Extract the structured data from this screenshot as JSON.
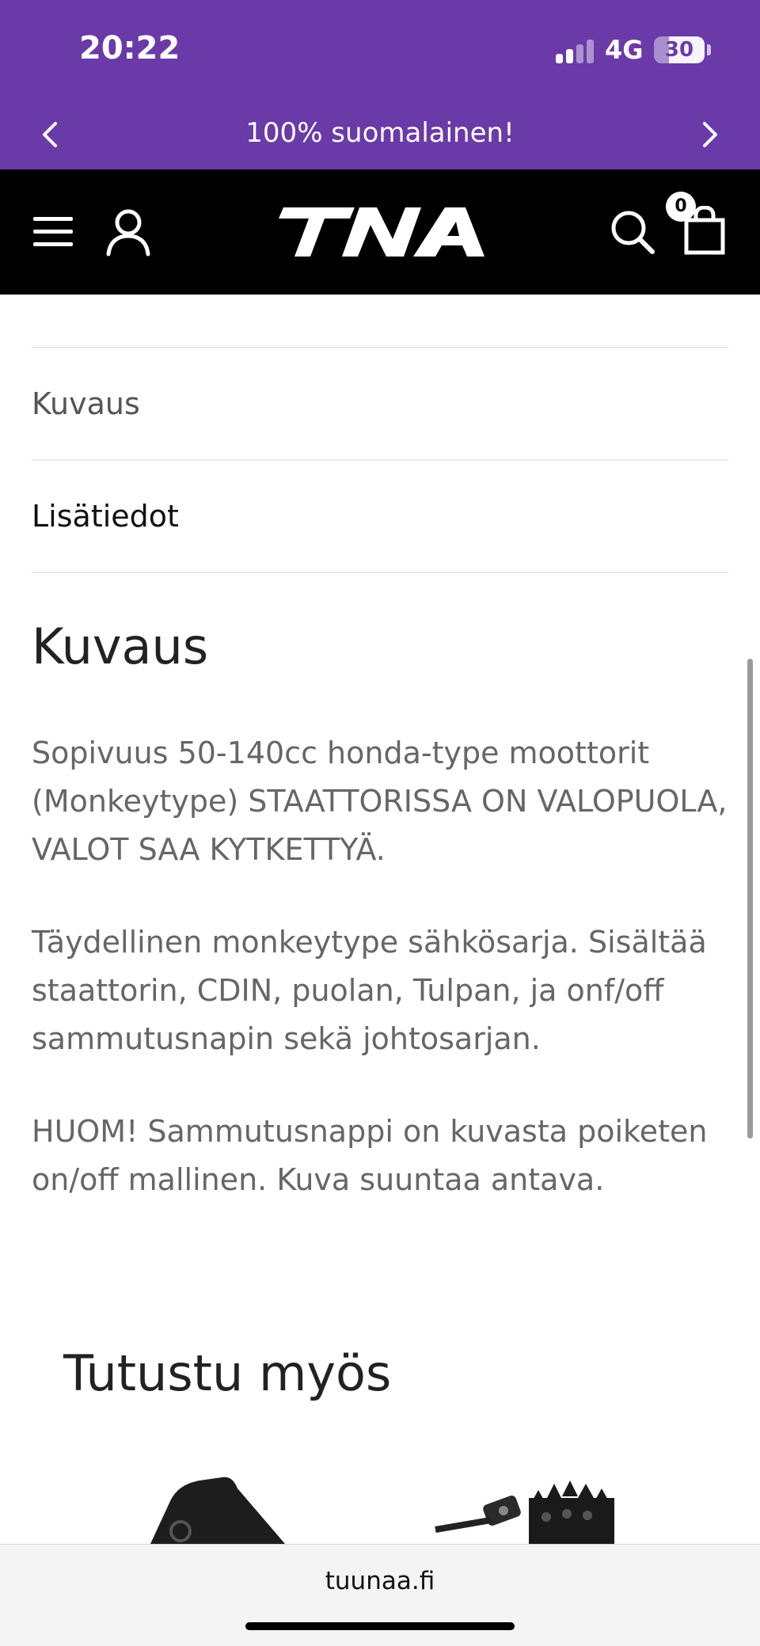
{
  "status_bar": {
    "time": "20:22",
    "network": "4G",
    "battery": "30",
    "battery_level": 0.3
  },
  "promo": {
    "text": "100% suomalainen!"
  },
  "header": {
    "logo": "TNA",
    "cart_count": "0"
  },
  "tabs": [
    {
      "label": "Kuvaus"
    },
    {
      "label": "Lisätiedot"
    }
  ],
  "description": {
    "title": "Kuvaus",
    "paragraphs": [
      "Sopivuus 50-140cc honda-type moottorit (Monkeytype) STAATTORISSA ON VALOPUOLA, VALOT SAA KYTKETTYÄ.",
      "Täydellinen monkeytype sähkösarja. Sisältää staattorin, CDIN, puolan, Tulpan, ja onf/off sammutusnapin sekä johtosarjan.",
      "HUOM! Sammutusnappi on kuvasta poiketen on/off mallinen. Kuva suuntaa antava."
    ]
  },
  "related": {
    "title": "Tutustu myös"
  },
  "browser": {
    "url": "tuunaa.fi"
  },
  "colors": {
    "brand_purple": "#6a3aa8",
    "header_black": "#000000",
    "text_grey": "#666666"
  },
  "icons": [
    "menu-icon",
    "account-icon",
    "search-icon",
    "cart-icon",
    "chevron-left-icon",
    "chevron-right-icon"
  ]
}
